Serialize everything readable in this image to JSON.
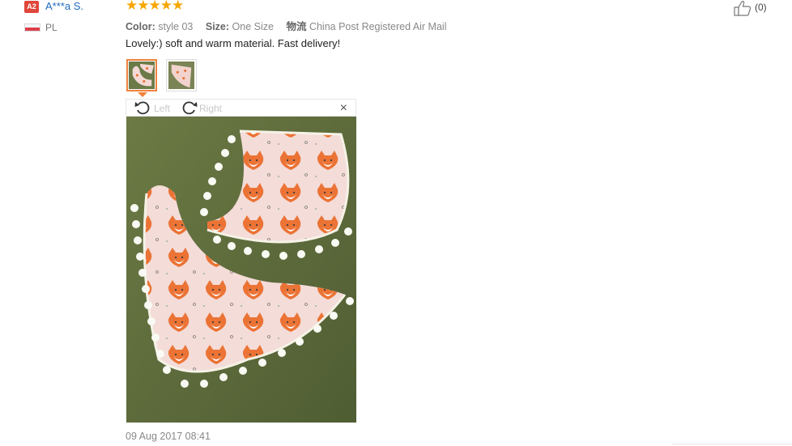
{
  "reviewer": {
    "level_badge": "A2",
    "name": "A***a S.",
    "country": "PL"
  },
  "rating": {
    "stars": 5,
    "display": "★★★★★"
  },
  "meta": {
    "color_label": "Color:",
    "color_value": "style 03",
    "size_label": "Size:",
    "size_value": "One Size",
    "shipping_label": "物流",
    "shipping_value": "China Post Registered Air Mail"
  },
  "review_text": "Lovely:) soft and warm material. Fast delivery!",
  "helpful": {
    "count": "(0)"
  },
  "thumbnails": [
    {
      "name": "photo-1",
      "active": true
    },
    {
      "name": "photo-2",
      "active": false
    }
  ],
  "viewer": {
    "rotate_left_label": "Left",
    "rotate_right_label": "Right",
    "close_label": "×"
  },
  "review_date": "09 Aug 2017 08:41",
  "colors": {
    "star": "#f7a600",
    "accent": "#f0823c",
    "badge": "#e0463a",
    "link": "#1f6bbf",
    "photo_bg": "#5b6a3a",
    "fabric": "#f4d9d5"
  }
}
